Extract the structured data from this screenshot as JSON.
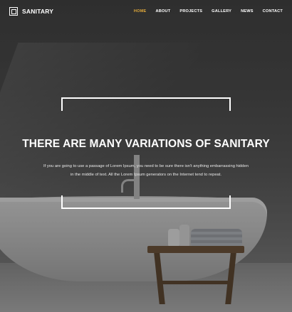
{
  "brand": {
    "name": "SANITARY",
    "accent": "#e0a93b"
  },
  "nav": {
    "items": [
      {
        "label": "HOME"
      },
      {
        "label": "ABOUT"
      },
      {
        "label": "PROJECTS"
      },
      {
        "label": "GALLERY"
      },
      {
        "label": "NEWS"
      },
      {
        "label": "CONTACT"
      }
    ]
  },
  "hero": {
    "title": "THERE ARE MANY VARIATIONS OF SANITARY",
    "description": "If you are going to use a passage of Lorem Ipsum, you need to be sure there isn't anything embarrassing hidden in the middle of text. All the Lorem Ipsum generators on the Internet tend to repeat."
  }
}
